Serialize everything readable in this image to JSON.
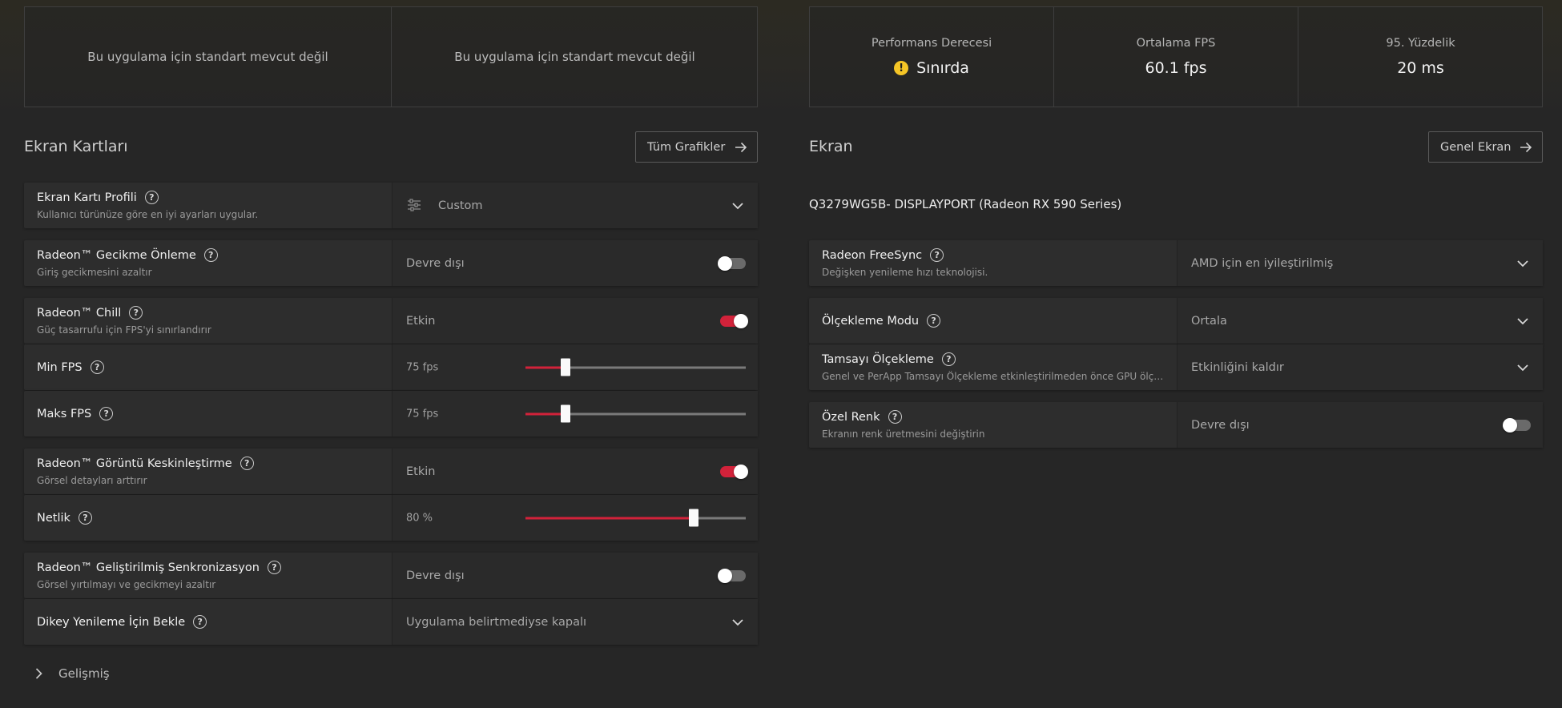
{
  "benchmark_left": {
    "cell1_text": "Bu uygulama için standart mevcut değil",
    "cell2_text": "Bu uygulama için standart mevcut değil"
  },
  "benchmark_right": {
    "rating_label": "Performans Derecesi",
    "rating_value": "Sınırda",
    "avg_fps_label": "Ortalama FPS",
    "avg_fps_value": "60.1 fps",
    "percentile_label": "95. Yüzdelik",
    "percentile_value": "20 ms"
  },
  "graphics": {
    "section_title": "Ekran Kartları",
    "all_graphics_button": "Tüm Grafikler",
    "profile": {
      "title": "Ekran Kartı Profili",
      "subtitle": "Kullanıcı türünüze göre en iyi ayarları uygular.",
      "value": "Custom"
    },
    "anti_lag": {
      "title": "Radeon™ Gecikme Önleme",
      "subtitle": "Giriş gecikmesini azaltır",
      "value": "Devre dışı",
      "enabled": false
    },
    "chill": {
      "title": "Radeon™ Chill",
      "subtitle": "Güç tasarrufu için FPS'yi sınırlandırır",
      "value": "Etkin",
      "enabled": true
    },
    "min_fps": {
      "title": "Min FPS",
      "value": "75 fps",
      "fraction": 0.18
    },
    "max_fps": {
      "title": "Maks FPS",
      "value": "75 fps",
      "fraction": 0.18
    },
    "sharpening": {
      "title": "Radeon™ Görüntü Keskinleştirme",
      "subtitle": "Görsel detayları arttırır",
      "value": "Etkin",
      "enabled": true
    },
    "sharpness": {
      "title": "Netlik",
      "value": "80 %",
      "fraction": 0.765
    },
    "enhanced_sync": {
      "title": "Radeon™ Geliştirilmiş Senkronizasyon",
      "subtitle": "Görsel yırtılmayı ve gecikmeyi azaltır",
      "value": "Devre dışı",
      "enabled": false
    },
    "vsync": {
      "title": "Dikey Yenileme İçin Bekle",
      "value": "Uygulama belirtmediyse kapalı"
    },
    "advanced_label": "Gelişmiş"
  },
  "display": {
    "section_title": "Ekran",
    "overall_display_button": "Genel Ekran",
    "display_name": "Q3279WG5B- DISPLAYPORT (Radeon RX 590 Series)",
    "freesync": {
      "title": "Radeon FreeSync",
      "subtitle": "Değişken yenileme hızı teknolojisi.",
      "value": "AMD için en iyileştirilmiş"
    },
    "scaling_mode": {
      "title": "Ölçekleme Modu",
      "value": "Ortala"
    },
    "integer_scaling": {
      "title": "Tamsayı Ölçekleme",
      "subtitle": "Genel ve PerApp Tamsayı Ölçekleme etkinleştirilmeden önce GPU ölçekle...",
      "value": "Etkinliğini kaldır"
    },
    "custom_color": {
      "title": "Özel Renk",
      "subtitle": "Ekranın renk üretmesini değiştirin",
      "value": "Devre dışı",
      "enabled": false
    }
  },
  "colors": {
    "accent": "#d2223a",
    "warning": "#f5c526"
  }
}
